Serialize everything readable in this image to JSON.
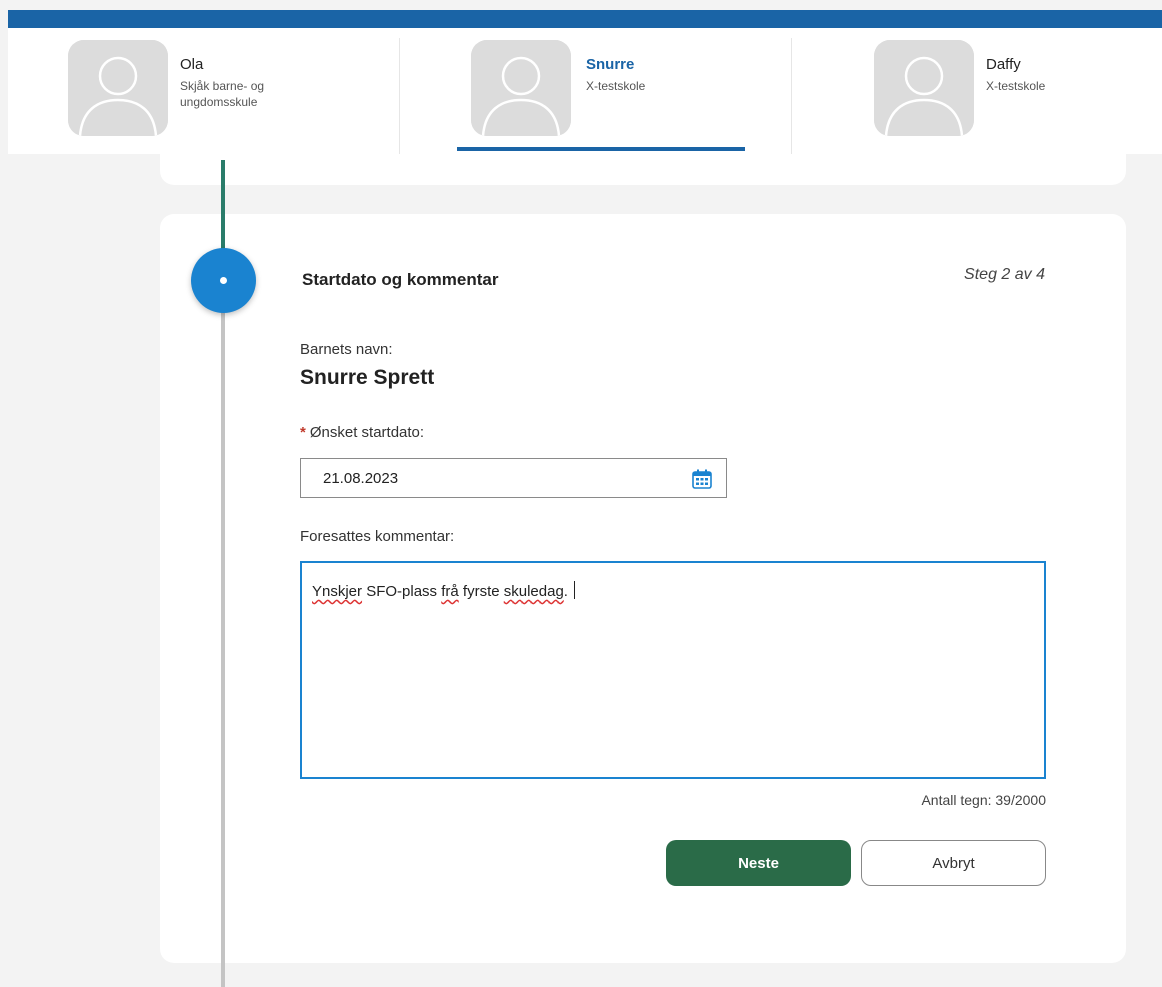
{
  "children": [
    {
      "name": "Ola",
      "school": "Skjåk barne- og ungdomsskule",
      "active": false,
      "avatar_icon": "person-silhouette-icon"
    },
    {
      "name": "Snurre",
      "school": "X-testskole",
      "active": true,
      "avatar_icon": "person-silhouette-icon"
    },
    {
      "name": "Daffy",
      "school": "X-testskole",
      "active": false,
      "avatar_icon": "person-silhouette-icon"
    }
  ],
  "step": {
    "title": "Startdato og kommentar",
    "info": "Steg 2 av 4"
  },
  "form": {
    "child_label": "Barnets navn:",
    "child_value": "Snurre Sprett",
    "date_required_marker": "*",
    "date_label": "Ønsket startdato:",
    "date_value": "21.08.2023",
    "comment_label": "Foresattes kommentar:",
    "comment_parts": {
      "w1": "Ynskjer",
      "w2": " SFO-plass ",
      "w3": "frå",
      "w4": " fyrste ",
      "w5": "skuledag",
      "w6": "."
    },
    "char_count": "Antall tegn: 39/2000"
  },
  "buttons": {
    "next": "Neste",
    "cancel": "Avbryt"
  },
  "colors": {
    "brand_blue": "#1a64a6",
    "step_blue": "#1a83d0",
    "primary_green": "#2a6b48",
    "timeline_green": "#2a7c6a",
    "required_red": "#c0392b"
  }
}
